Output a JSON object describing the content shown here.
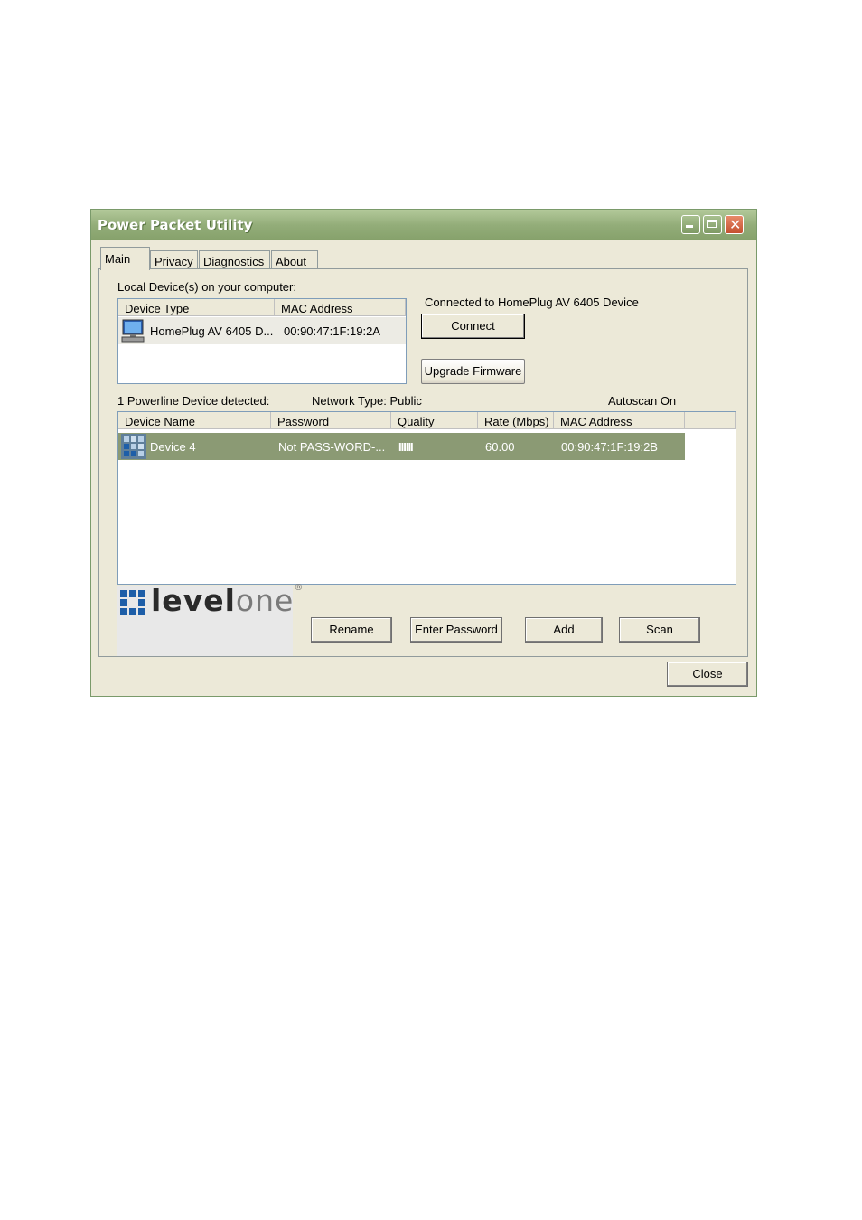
{
  "window": {
    "title": "Power Packet Utility"
  },
  "tabs": [
    {
      "label": "Main"
    },
    {
      "label": "Privacy"
    },
    {
      "label": "Diagnostics"
    },
    {
      "label": "About"
    }
  ],
  "local": {
    "label": "Local Device(s) on your computer:",
    "columns": [
      "Device Type",
      "MAC Address"
    ],
    "rows": [
      {
        "device_type": "HomePlug AV 6405 D...",
        "mac": "00:90:47:1F:19:2A",
        "icon": "computer-icon"
      }
    ]
  },
  "connection": {
    "status": "Connected to HomePlug AV 6405 Device",
    "connect_label": "Connect",
    "upgrade_label": "Upgrade Firmware"
  },
  "status_bar": {
    "detected": "1 Powerline Device detected:",
    "network": "Network Type: Public",
    "autoscan": "Autoscan On"
  },
  "remote": {
    "columns": [
      "Device Name",
      "Password",
      "Quality",
      "Rate (Mbps)",
      "MAC Address"
    ],
    "rows": [
      {
        "name": "Device 4",
        "password": "Not PASS-WORD-...",
        "quality": "IIIIII",
        "rate": "60.00",
        "mac": "00:90:47:1F:19:2B",
        "icon": "powerline-device-icon"
      }
    ]
  },
  "logo": {
    "text_a": "level",
    "text_b": "one",
    "mark": "®"
  },
  "buttons": {
    "rename": "Rename",
    "enter_password": "Enter Password",
    "add": "Add",
    "scan": "Scan",
    "close": "Close"
  },
  "colors": {
    "selection": "#8b9a74",
    "title_bar": "#93ad79",
    "logo_blue": "#1d5ea8"
  }
}
